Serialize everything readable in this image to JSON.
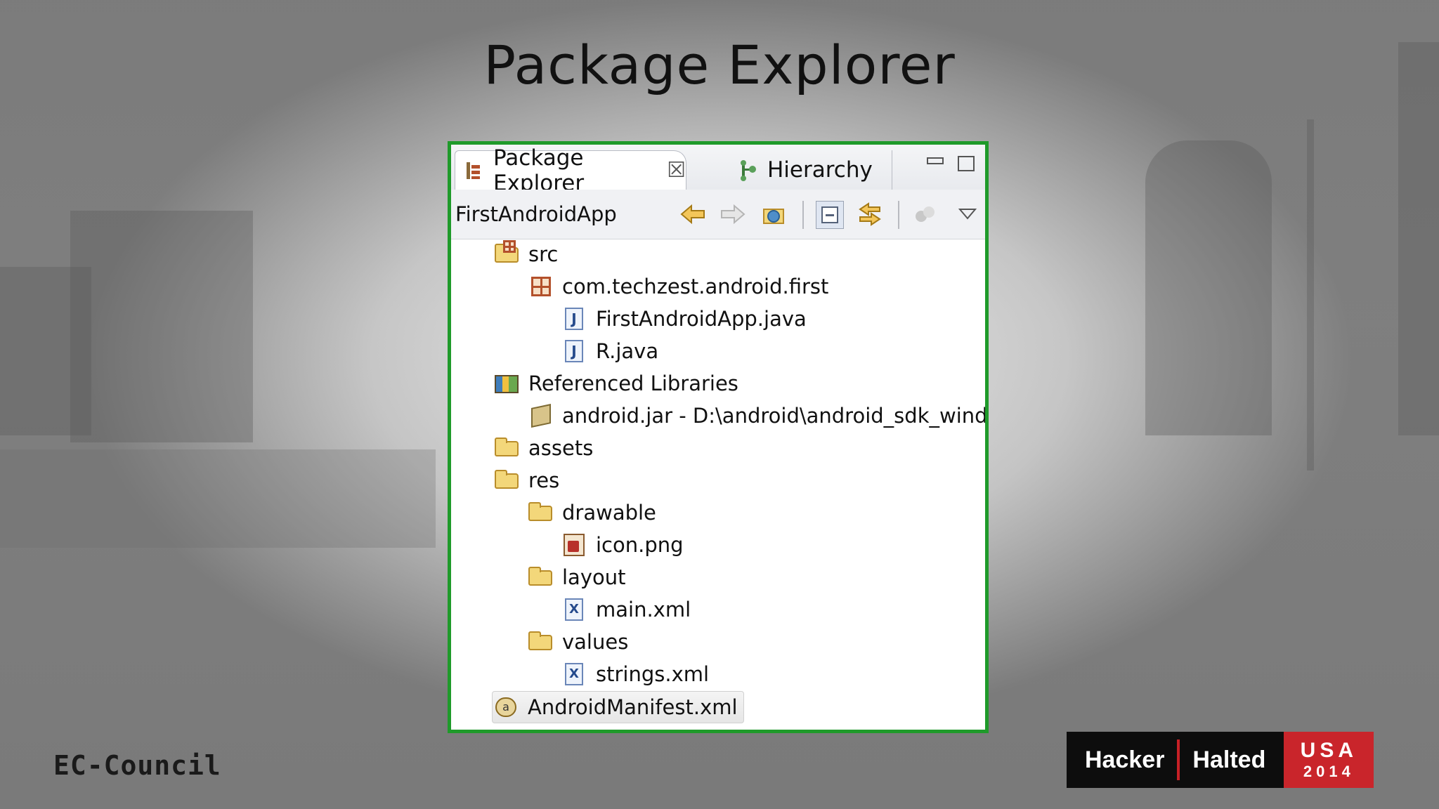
{
  "slide": {
    "title": "Package Explorer"
  },
  "panel": {
    "tabs": [
      {
        "label": "Package Explorer",
        "icon": "package-explorer-icon",
        "active": true
      },
      {
        "label": "Hierarchy",
        "icon": "hierarchy-icon",
        "active": false
      }
    ],
    "close_glyph": "☒",
    "breadcrumb": "FirstAndroidApp",
    "tree": [
      {
        "label": "src",
        "icon": "source-folder-icon"
      },
      {
        "label": "com.techzest.android.first",
        "icon": "package-icon"
      },
      {
        "label": "FirstAndroidApp.java",
        "icon": "java-file-icon"
      },
      {
        "label": "R.java",
        "icon": "java-file-icon"
      },
      {
        "label": "Referenced Libraries",
        "icon": "libraries-icon"
      },
      {
        "label": "android.jar - D:\\android\\android_sdk_windo",
        "icon": "jar-icon"
      },
      {
        "label": "assets",
        "icon": "folder-icon"
      },
      {
        "label": "res",
        "icon": "folder-icon"
      },
      {
        "label": "drawable",
        "icon": "folder-icon"
      },
      {
        "label": "icon.png",
        "icon": "image-file-icon"
      },
      {
        "label": "layout",
        "icon": "folder-icon"
      },
      {
        "label": "main.xml",
        "icon": "xml-file-icon"
      },
      {
        "label": "values",
        "icon": "folder-icon"
      },
      {
        "label": "strings.xml",
        "icon": "xml-file-icon"
      },
      {
        "label": "AndroidManifest.xml",
        "icon": "manifest-icon"
      }
    ]
  },
  "branding": {
    "left": "EC-Council",
    "right_word1": "Hacker",
    "right_word2": "Halted",
    "right_region": "USA",
    "right_year": "2014",
    "colors": {
      "frame_green": "#1f9a2a",
      "brand_red": "#c9252b"
    }
  }
}
